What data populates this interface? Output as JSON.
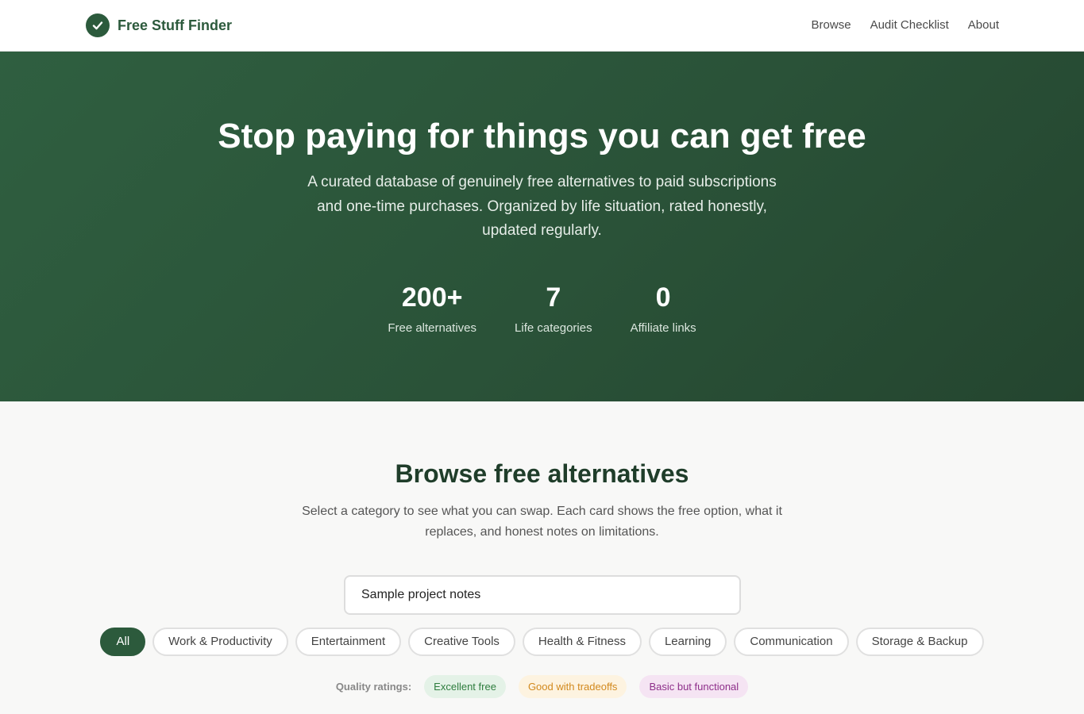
{
  "header": {
    "brand": "Free Stuff Finder",
    "nav": [
      "Browse",
      "Audit Checklist",
      "About"
    ]
  },
  "hero": {
    "title": "Stop paying for things you can get free",
    "lede": "A curated database of genuinely free alternatives to paid subscriptions and one-time purchases. Organized by life situation, rated honestly, updated regularly.",
    "stats": [
      {
        "value": "200+",
        "label": "Free alternatives"
      },
      {
        "value": "7",
        "label": "Life categories"
      },
      {
        "value": "0",
        "label": "Affiliate links"
      }
    ]
  },
  "browse": {
    "title": "Browse free alternatives",
    "subtitle": "Select a category to see what you can swap. Each card shows the free option, what it replaces, and honest notes on limitations.",
    "search_value": "Sample project notes",
    "categories": [
      "All",
      "Work & Productivity",
      "Entertainment",
      "Creative Tools",
      "Health & Fitness",
      "Learning",
      "Communication",
      "Storage & Backup"
    ],
    "active_category": "All",
    "ratings_label": "Quality ratings:",
    "ratings": [
      "Excellent free",
      "Good with tradeoffs",
      "Basic but functional"
    ]
  },
  "colors": {
    "brand": "#2c5a3c",
    "hero_bg": "#2a5238",
    "excellent": "#2e7d3e",
    "good": "#d2891d",
    "basic": "#8e2f8a"
  },
  "icons": {
    "brand": "checkmark-circle-icon"
  }
}
